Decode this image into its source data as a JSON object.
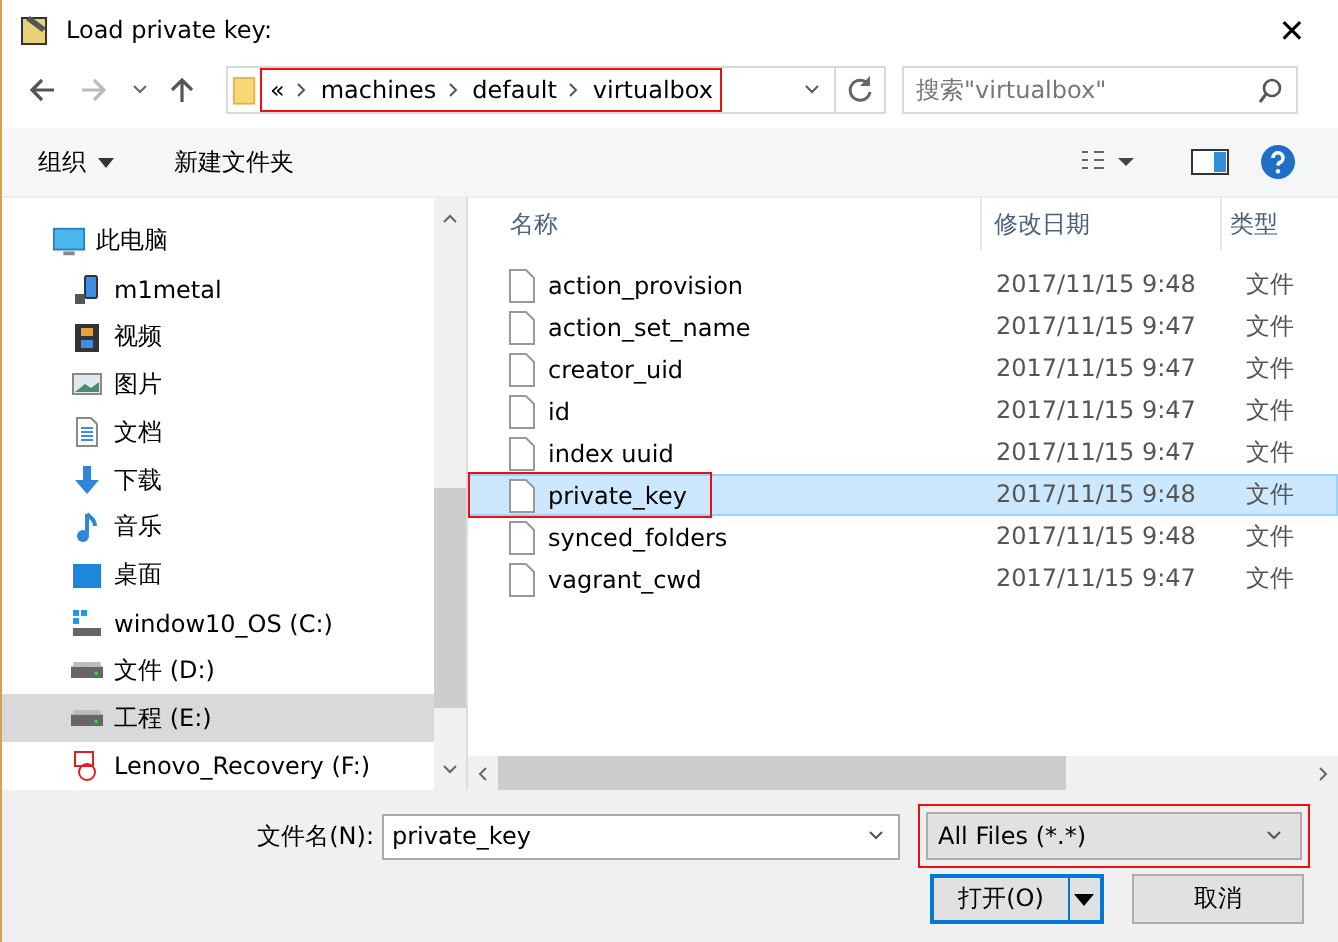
{
  "window": {
    "title": "Load private key:",
    "close": "✕"
  },
  "address": {
    "overflow": "«",
    "segments": [
      "machines",
      "default",
      "virtualbox"
    ],
    "highlighted": true
  },
  "search": {
    "placeholder": "搜索\"virtualbox\""
  },
  "toolbar": {
    "organize": "组织",
    "new_folder": "新建文件夹"
  },
  "sidebar": {
    "items": [
      {
        "label": "此电脑",
        "kind": "pc",
        "selected": false,
        "children": [
          {
            "label": "m1metal",
            "kind": "phone",
            "selected": false
          },
          {
            "label": "视频",
            "kind": "video",
            "selected": false
          },
          {
            "label": "图片",
            "kind": "image",
            "selected": false
          },
          {
            "label": "文档",
            "kind": "doc",
            "selected": false
          },
          {
            "label": "下载",
            "kind": "download",
            "selected": false
          },
          {
            "label": "音乐",
            "kind": "music",
            "selected": false
          },
          {
            "label": "桌面",
            "kind": "desktop",
            "selected": false
          },
          {
            "label": "window10_OS (C:)",
            "kind": "osdrive",
            "selected": false
          },
          {
            "label": "文件 (D:)",
            "kind": "drive",
            "selected": false
          },
          {
            "label": "工程 (E:)",
            "kind": "drive",
            "selected": true
          },
          {
            "label": "Lenovo_Recovery (F:)",
            "kind": "recovery",
            "selected": false
          }
        ]
      }
    ]
  },
  "table": {
    "columns": [
      "名称",
      "修改日期",
      "类型"
    ],
    "rows": [
      {
        "name": "action_provision",
        "date": "2017/11/15 9:48",
        "type": "文件",
        "selected": false,
        "highlighted": false
      },
      {
        "name": "action_set_name",
        "date": "2017/11/15 9:47",
        "type": "文件",
        "selected": false,
        "highlighted": false
      },
      {
        "name": "creator_uid",
        "date": "2017/11/15 9:47",
        "type": "文件",
        "selected": false,
        "highlighted": false
      },
      {
        "name": "id",
        "date": "2017/11/15 9:47",
        "type": "文件",
        "selected": false,
        "highlighted": false
      },
      {
        "name": "index uuid",
        "date": "2017/11/15 9:47",
        "type": "文件",
        "selected": false,
        "highlighted": false
      },
      {
        "name": "private_key",
        "date": "2017/11/15 9:48",
        "type": "文件",
        "selected": true,
        "highlighted": true
      },
      {
        "name": "synced_folders",
        "date": "2017/11/15 9:48",
        "type": "文件",
        "selected": false,
        "highlighted": false
      },
      {
        "name": "vagrant_cwd",
        "date": "2017/11/15 9:47",
        "type": "文件",
        "selected": false,
        "highlighted": false
      }
    ]
  },
  "footer": {
    "filename_label": "文件名(N):",
    "filename": "private_key",
    "filter": {
      "value": "All Files (*.*)",
      "highlighted": true
    },
    "open": "打开(O)",
    "cancel": "取消"
  }
}
